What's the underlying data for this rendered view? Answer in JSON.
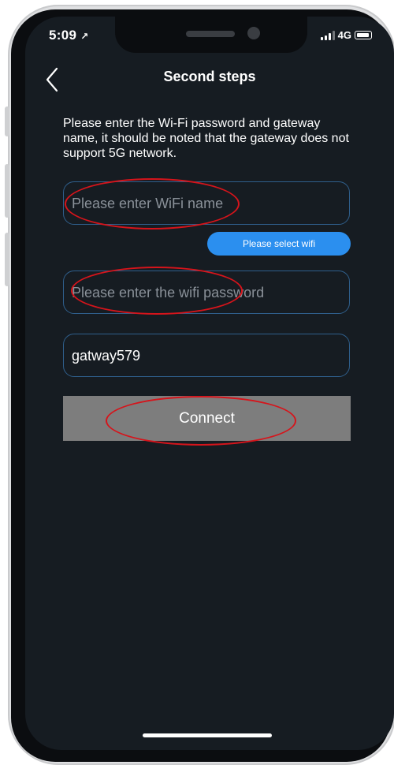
{
  "status_bar": {
    "time": "5:09",
    "network": "4G"
  },
  "header": {
    "title": "Second steps"
  },
  "instructions": "Please enter the Wi-Fi password and gateway name, it should be noted that the gateway does not support 5G network.",
  "wifi_name": {
    "placeholder": "Please enter WiFi name",
    "value": ""
  },
  "select_wifi_label": "Please select wifi",
  "wifi_password": {
    "placeholder": "Please enter the wifi password",
    "value": ""
  },
  "gateway_name": {
    "value": "gatway579"
  },
  "connect_label": "Connect",
  "colors": {
    "background": "#161c22",
    "field_border": "#2f5f8c",
    "accent_button": "#2b8fef",
    "connect_button": "#7d7d7d",
    "annotation": "#d6141b"
  }
}
